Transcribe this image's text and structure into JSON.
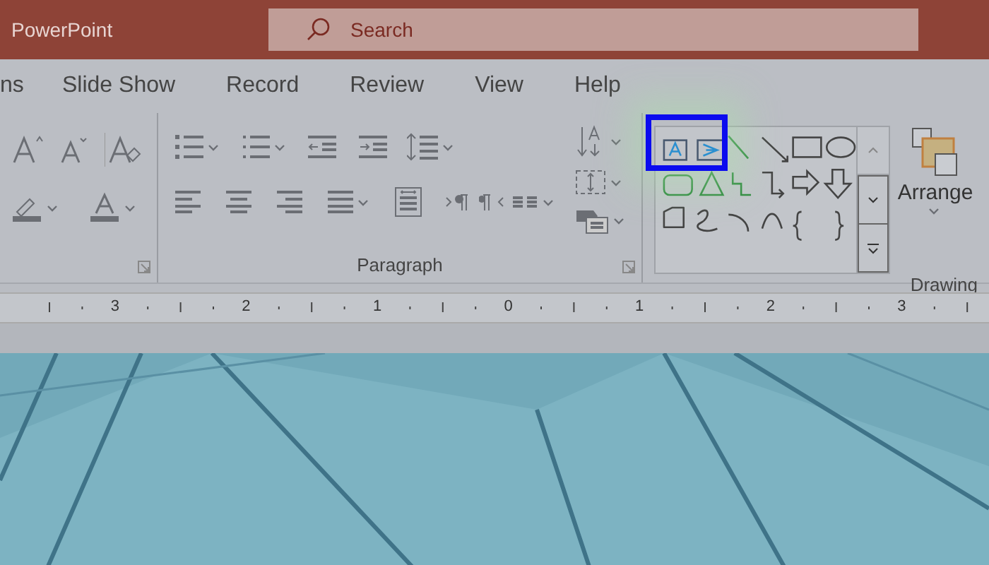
{
  "window": {
    "title": "PowerPoint"
  },
  "search": {
    "placeholder": "Search"
  },
  "tabs": [
    {
      "label": "ns"
    },
    {
      "label": "Slide Show"
    },
    {
      "label": "Record"
    },
    {
      "label": "Review"
    },
    {
      "label": "View"
    },
    {
      "label": "Help"
    }
  ],
  "ribbon": {
    "groups": [
      {
        "label": "Paragraph"
      },
      {
        "label": "Drawing"
      }
    ],
    "arrange_button": {
      "label": "Arrange"
    }
  },
  "ruler": {
    "labels": [
      "3",
      "2",
      "1",
      "0",
      "1",
      "2",
      "3"
    ]
  }
}
